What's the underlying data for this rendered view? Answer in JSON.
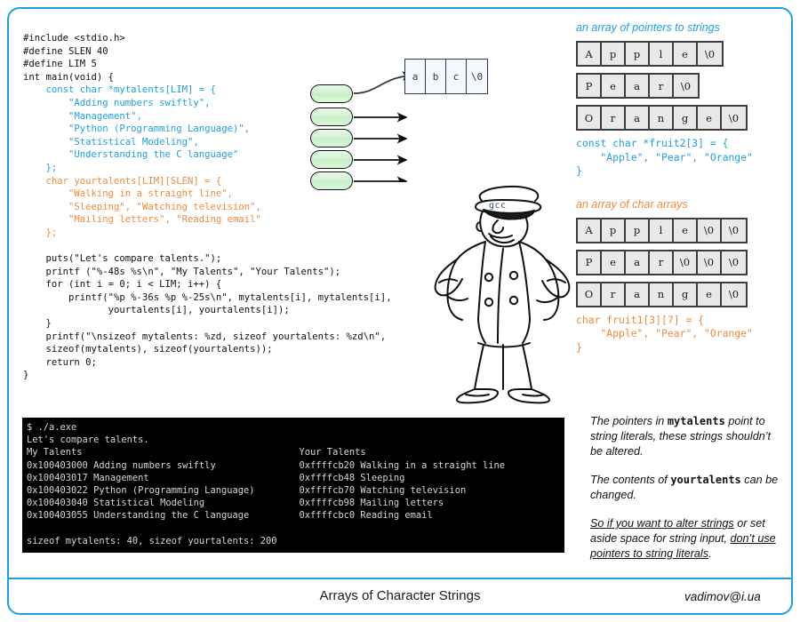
{
  "document": {
    "title": "Arrays of Character Strings",
    "signature": "vadimov@i.ua",
    "frame_color": "#1e9fe0"
  },
  "code": {
    "language": "c",
    "lines": [
      [
        {
          "t": "#include <stdio.h>",
          "c": "plain"
        }
      ],
      [
        {
          "t": "#define SLEN 40",
          "c": "plain"
        }
      ],
      [
        {
          "t": "#define LIM 5",
          "c": "plain"
        }
      ],
      [
        {
          "t": "int main(void) {",
          "c": "plain"
        }
      ],
      [
        {
          "t": "    const char *mytalents[LIM] = {",
          "c": "blue"
        }
      ],
      [
        {
          "t": "        \"Adding numbers swiftly\",",
          "c": "blue"
        }
      ],
      [
        {
          "t": "        \"Management\",",
          "c": "blue"
        }
      ],
      [
        {
          "t": "        \"Python (Programming Language)\",",
          "c": "blue"
        }
      ],
      [
        {
          "t": "        \"Statistical Modeling\",",
          "c": "blue"
        }
      ],
      [
        {
          "t": "        \"Understanding the C language\"",
          "c": "blue"
        }
      ],
      [
        {
          "t": "    };",
          "c": "blue"
        }
      ],
      [
        {
          "t": "    char yourtalents[LIM][SLEN] = {",
          "c": "orange"
        }
      ],
      [
        {
          "t": "        \"Walking in a straight line\",",
          "c": "orange"
        }
      ],
      [
        {
          "t": "        \"Sleeping\", \"Watching television\",",
          "c": "orange"
        }
      ],
      [
        {
          "t": "        \"Mailing letters\", \"Reading email\"",
          "c": "orange"
        }
      ],
      [
        {
          "t": "    };",
          "c": "orange"
        }
      ],
      [
        {
          "t": "",
          "c": "plain"
        }
      ],
      [
        {
          "t": "    puts(\"Let's compare talents.\");",
          "c": "plain"
        }
      ],
      [
        {
          "t": "    printf (\"%-48s %s\\n\", \"My Talents\", \"Your Talents\");",
          "c": "plain"
        }
      ],
      [
        {
          "t": "    for (int i = 0; i < LIM; i++) {",
          "c": "plain"
        }
      ],
      [
        {
          "t": "        printf(\"%p %-36s %p %-25s\\n\", mytalents[i], mytalents[i],",
          "c": "plain"
        }
      ],
      [
        {
          "t": "               yourtalents[i], yourtalents[i]);",
          "c": "plain"
        }
      ],
      [
        {
          "t": "    }",
          "c": "plain"
        }
      ],
      [
        {
          "t": "    printf(\"\\nsizeof mytalents: %zd, sizeof yourtalents: %zd\\n\",",
          "c": "plain"
        }
      ],
      [
        {
          "t": "    sizeof(mytalents), sizeof(yourtalents));",
          "c": "plain"
        }
      ],
      [
        {
          "t": "    return 0;",
          "c": "plain"
        }
      ],
      [
        {
          "t": "}",
          "c": "plain"
        }
      ]
    ]
  },
  "pointer_diagram": {
    "pointer_count": 5,
    "string_cells": [
      "a",
      "b",
      "c",
      "\\0"
    ]
  },
  "mascot": {
    "cap_label": "gcc",
    "name": "gcc-policeman"
  },
  "arrays": {
    "pointers_section": {
      "caption": "an array of pointers to strings",
      "color": "#1e9fe0",
      "rows": [
        [
          "A",
          "p",
          "p",
          "l",
          "e",
          "\\0"
        ],
        [
          "P",
          "e",
          "a",
          "r",
          "\\0"
        ],
        [
          "O",
          "r",
          "a",
          "n",
          "g",
          "e",
          "\\0"
        ]
      ],
      "code": "const char *fruit2[3] = {\n    \"Apple\", \"Pear\", \"Orange\"\n}"
    },
    "chararrays_section": {
      "caption": "an array of char arrays",
      "color": "#f08a3c",
      "rows": [
        [
          "A",
          "p",
          "p",
          "l",
          "e",
          "\\0",
          "\\0"
        ],
        [
          "P",
          "e",
          "a",
          "r",
          "\\0",
          "\\0",
          "\\0"
        ],
        [
          "O",
          "r",
          "a",
          "n",
          "g",
          "e",
          "\\0"
        ]
      ],
      "code": "char fruit1[3][7] = {\n    \"Apple\", \"Pear\", \"Orange\"\n}"
    }
  },
  "notes": [
    {
      "id": "note-mytalents",
      "parts": [
        {
          "t": "The pointers in ",
          "style": "italic"
        },
        {
          "t": "mytalents",
          "style": "mono-bold"
        },
        {
          "t": " point to string literals, these strings shouldn’t be altered.",
          "style": "italic"
        }
      ]
    },
    {
      "id": "note-yourtalents",
      "parts": [
        {
          "t": "The contents of ",
          "style": "italic"
        },
        {
          "t": "yourtalents",
          "style": "mono-bold"
        },
        {
          "t": " can be changed.",
          "style": "italic"
        }
      ]
    },
    {
      "id": "note-advice",
      "parts": [
        {
          "t": "So if you want to alter strings",
          "style": "italic-underline"
        },
        {
          "t": " or set aside space for string input, ",
          "style": "italic"
        },
        {
          "t": "don’t use pointers to string literals",
          "style": "italic-underline"
        },
        {
          "t": ".",
          "style": "italic"
        }
      ]
    }
  ],
  "terminal": {
    "prompt_line": "$ ./a.exe",
    "lines": [
      "$ ./a.exe",
      "Let's compare talents.",
      "My Talents                                       Your Talents",
      "0x100403000 Adding numbers swiftly               0xffffcb20 Walking in a straight line",
      "0x100403017 Management                           0xffffcb48 Sleeping",
      "0x100403022 Python (Programming Language)        0xffffcb70 Watching television",
      "0x100403040 Statistical Modeling                 0xffffcb98 Mailing letters",
      "0x100403055 Understanding the C language         0xffffcbc0 Reading email",
      "",
      "sizeof mytalents: 40, sizeof yourtalents: 200"
    ],
    "background": "#000000",
    "foreground": "#d6d6d6"
  }
}
